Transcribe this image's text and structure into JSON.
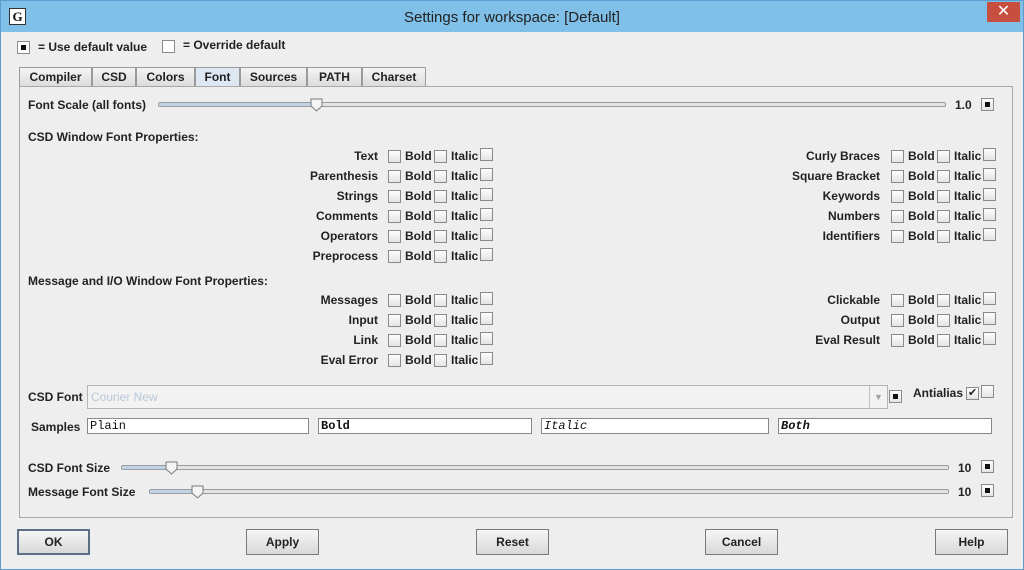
{
  "window": {
    "title": "Settings for workspace: [Default]",
    "app_icon": "G",
    "close_glyph": "✕"
  },
  "legend": {
    "default_label": "= Use default value",
    "override_label": "= Override default"
  },
  "tabs": [
    {
      "label": "Compiler"
    },
    {
      "label": "CSD"
    },
    {
      "label": "Colors"
    },
    {
      "label": "Font",
      "active": true
    },
    {
      "label": "Sources"
    },
    {
      "label": "PATH"
    },
    {
      "label": "Charset"
    }
  ],
  "font_scale": {
    "label": "Font Scale (all fonts)",
    "value_text": "1.0",
    "value": 1.0,
    "min": 0.5,
    "max": 3.0
  },
  "csd_section": {
    "heading": "CSD Window Font Properties:",
    "left": [
      {
        "label": "Text"
      },
      {
        "label": "Parenthesis"
      },
      {
        "label": "Strings"
      },
      {
        "label": "Comments"
      },
      {
        "label": "Operators"
      },
      {
        "label": "Preprocess"
      }
    ],
    "right": [
      {
        "label": "Curly Braces"
      },
      {
        "label": "Square Bracket"
      },
      {
        "label": "Keywords"
      },
      {
        "label": "Numbers"
      },
      {
        "label": "Identifiers"
      }
    ]
  },
  "io_section": {
    "heading": "Message and I/O Window Font Properties:",
    "left": [
      {
        "label": "Messages"
      },
      {
        "label": "Input"
      },
      {
        "label": "Link"
      },
      {
        "label": "Eval Error"
      }
    ],
    "right": [
      {
        "label": "Clickable"
      },
      {
        "label": "Output"
      },
      {
        "label": "Eval Result"
      }
    ]
  },
  "bold_label": "Bold",
  "italic_label": "Italic",
  "csd_font": {
    "label": "CSD Font",
    "value": "Courier New",
    "antialias_label": "Antialias",
    "antialias_checked": true
  },
  "samples": {
    "label": "Samples",
    "plain": "Plain",
    "bold": "Bold",
    "italic": "Italic",
    "both": "Both"
  },
  "csd_font_size": {
    "label": "CSD Font Size",
    "value_text": "10",
    "value": 10,
    "min": 6,
    "max": 72
  },
  "message_font_size": {
    "label": "Message Font Size",
    "value_text": "10",
    "value": 10,
    "min": 6,
    "max": 72
  },
  "buttons": {
    "ok": "OK",
    "apply": "Apply",
    "reset": "Reset",
    "cancel": "Cancel",
    "help": "Help"
  },
  "colors": {
    "titlebar": "#7fbfe8",
    "close": "#c74f3f",
    "active_tab": "#dde8f3"
  }
}
